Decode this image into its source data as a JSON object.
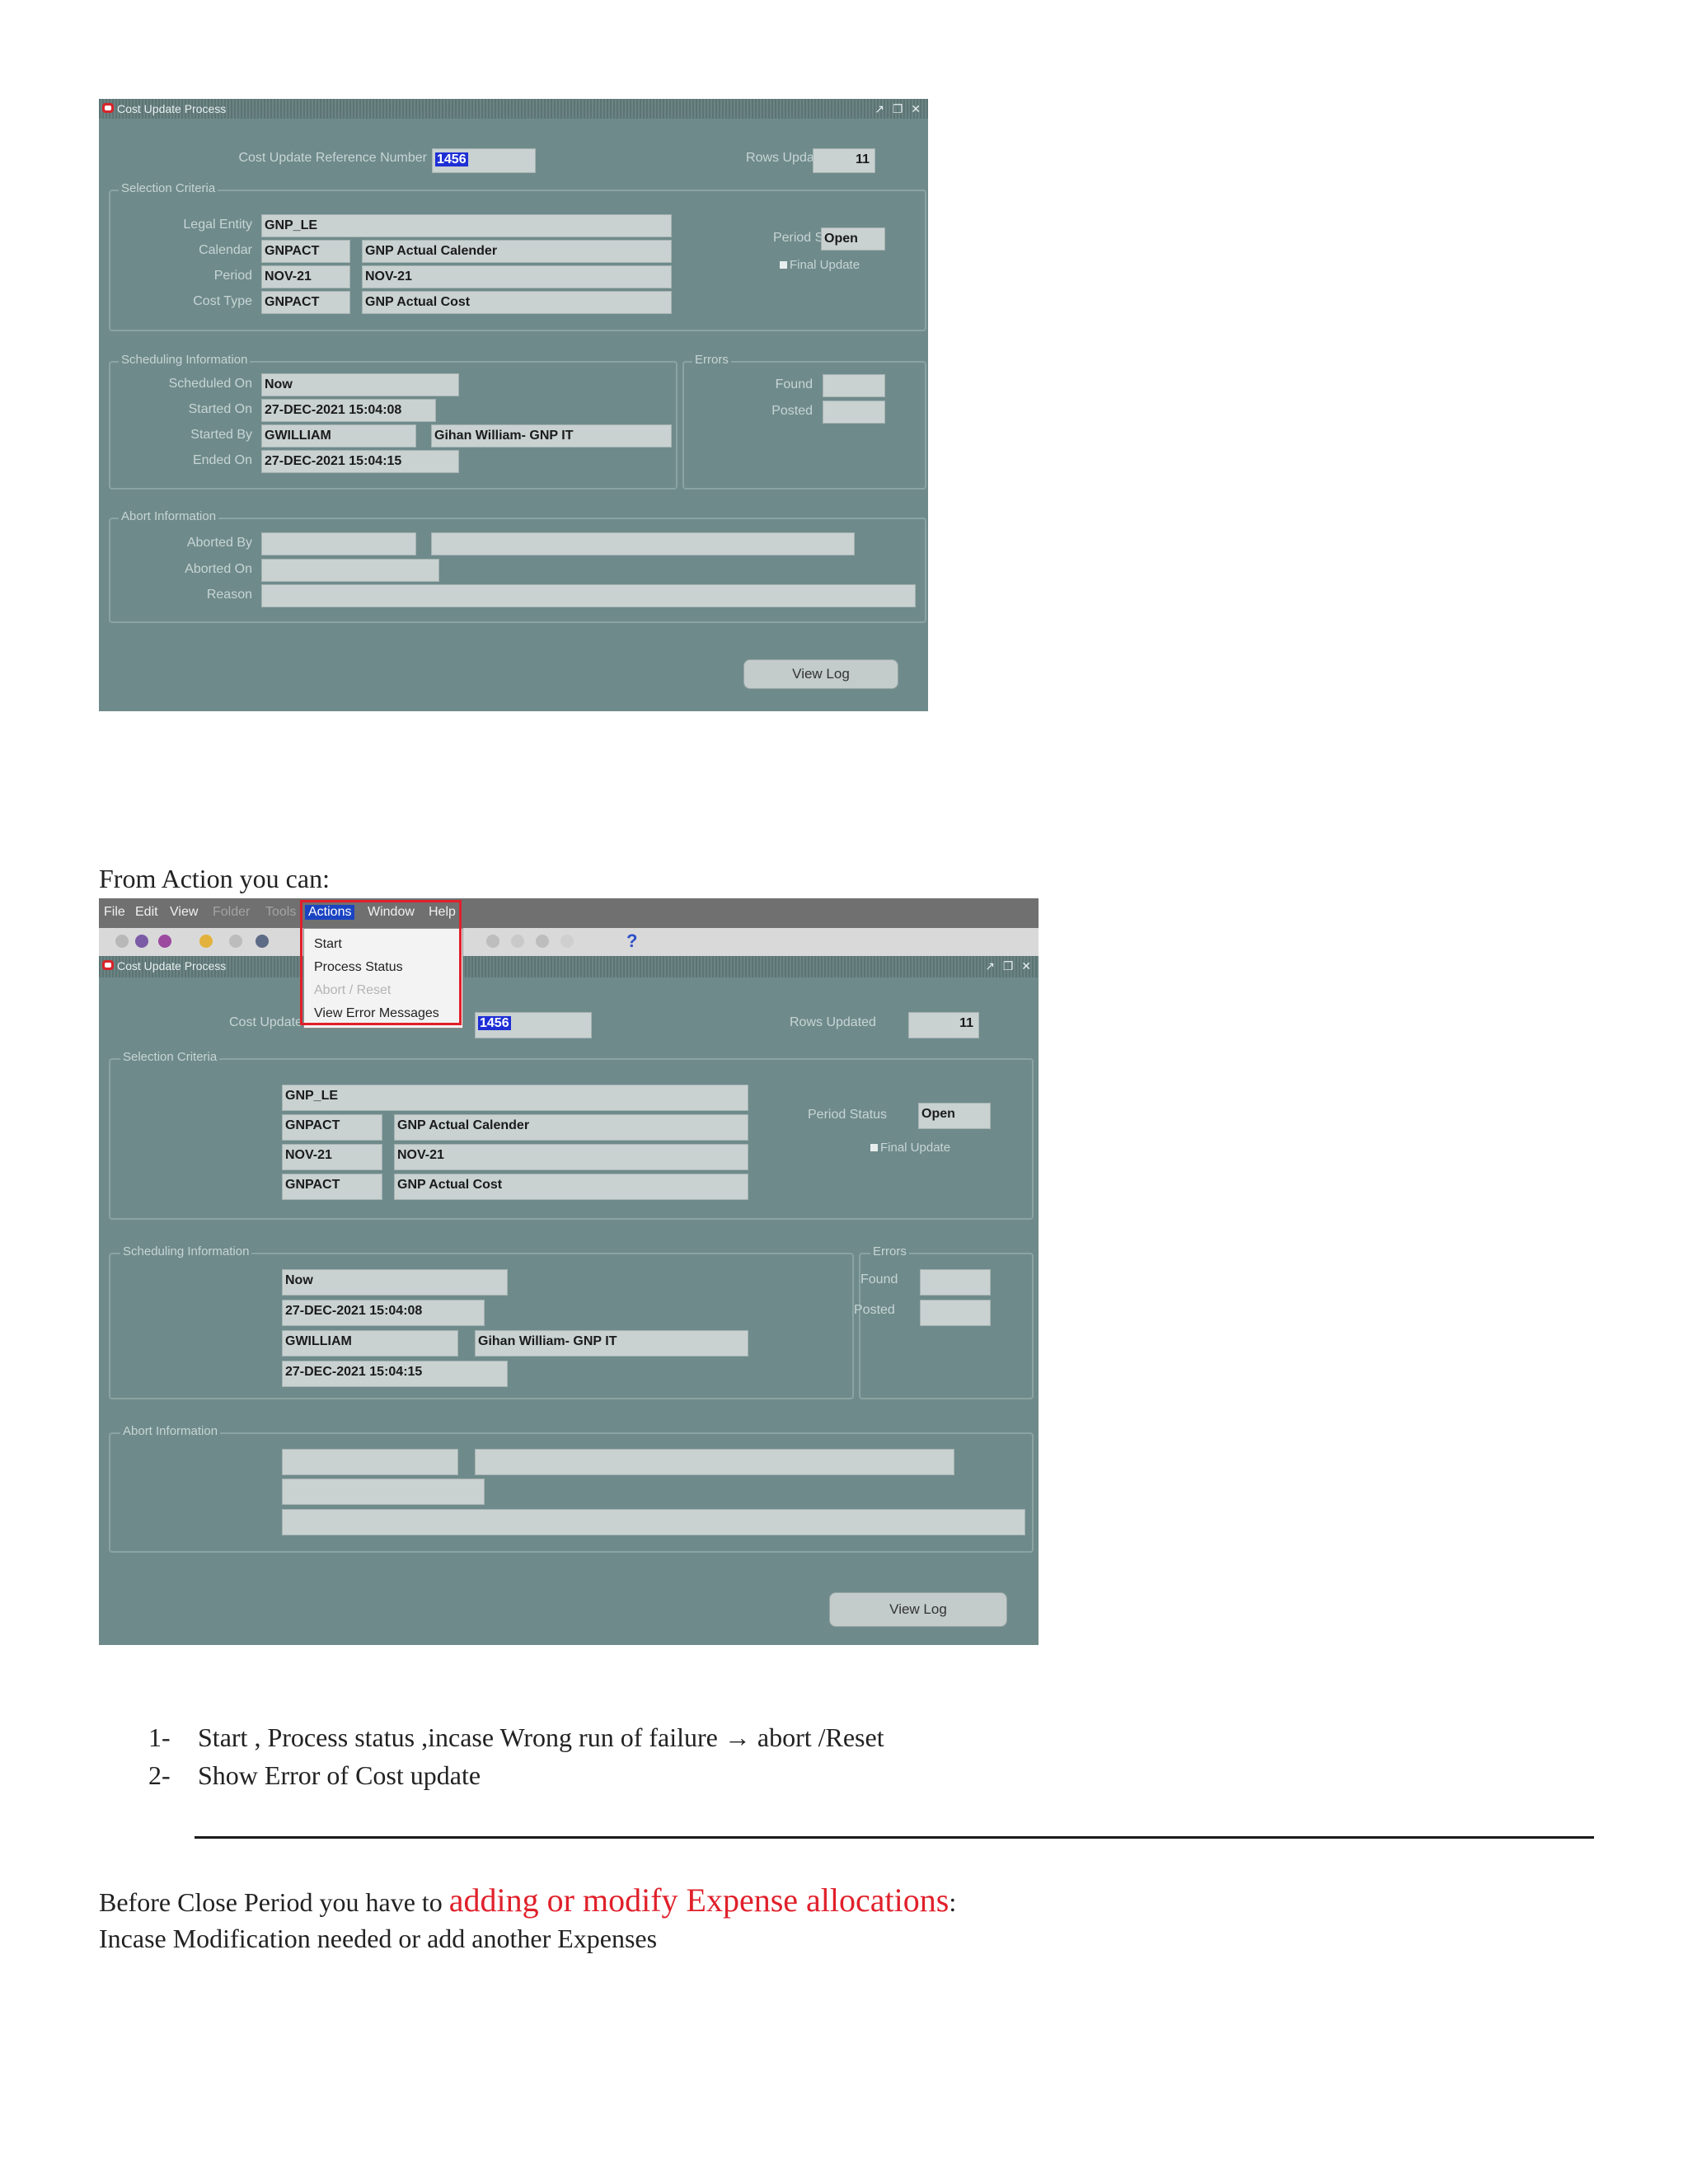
{
  "form": {
    "window_title": "Cost Update Process",
    "window_controls": "↗ ❐ ✕",
    "ref_label": "Cost Update Reference Number",
    "ref_value": "1456",
    "rows_label": "Rows Updated",
    "rows_value": "11",
    "selection_title": "Selection Criteria",
    "legal_entity_label": "Legal Entity",
    "legal_entity_value": "GNP_LE",
    "calendar_label": "Calendar",
    "calendar_code": "GNPACT",
    "calendar_name": "GNP Actual Calender",
    "period_label": "Period",
    "period_code": "NOV-21",
    "period_name": "NOV-21",
    "cost_type_label": "Cost Type",
    "cost_type_code": "GNPACT",
    "cost_type_name": "GNP Actual Cost",
    "period_status_label": "Period Status",
    "period_status_value": "Open",
    "final_update_label": "Final Update",
    "scheduling_title": "Scheduling Information",
    "scheduled_on_label": "Scheduled On",
    "scheduled_on_value": "Now",
    "started_on_label": "Started On",
    "started_on_value": "27-DEC-2021 15:04:08",
    "started_by_label": "Started By",
    "started_by_user": "GWILLIAM",
    "started_by_name": "Gihan William- GNP IT",
    "ended_on_label": "Ended On",
    "ended_on_value": "27-DEC-2021 15:04:15",
    "errors_title": "Errors",
    "found_label": "Found",
    "posted_label": "Posted",
    "abort_title": "Abort Information",
    "aborted_by_label": "Aborted By",
    "aborted_on_label": "Aborted On",
    "reason_label": "Reason",
    "view_log_label": "View Log"
  },
  "menubar": {
    "file": "File",
    "edit": "Edit",
    "view": "View",
    "folder": "Folder",
    "tools": "Tools",
    "actions": "Actions",
    "window": "Window",
    "help": "Help"
  },
  "actions_menu": {
    "start": "Start",
    "process_status": "Process Status",
    "abort_reset": "Abort / Reset",
    "view_error_messages": "View Error Messages"
  },
  "doc": {
    "intro": "From Action you can:",
    "item1_num": "1-",
    "item1_text": "Start , Process status  ,incase Wrong run of failure → abort /Reset",
    "item2_num": "2-",
    "item2_text": "Show Error of Cost update",
    "before_close_prefix": "Before Close Period you have to ",
    "before_close_red": "adding  or modify  Expense  allocations",
    "before_close_suffix": ":",
    "incase": "Incase Modification needed or add another Expenses"
  },
  "colors": {
    "form_bg": "#6f8a8a",
    "field_bg": "#c9d1d1",
    "selection_blue": "#1e2fd6",
    "highlight_red": "#e0202a"
  }
}
